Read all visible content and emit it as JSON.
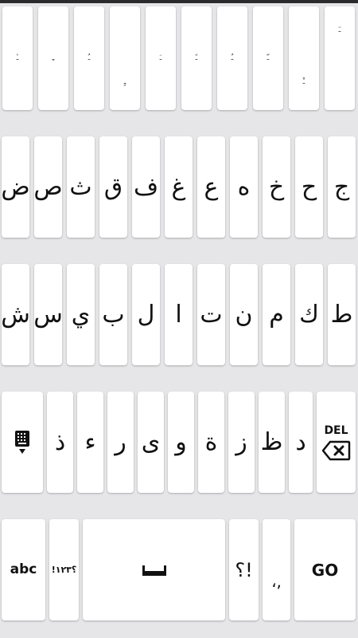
{
  "keyboard": {
    "row1": [
      "ـٔ",
      "ـِ",
      "ـُ",
      "ـٍ",
      "ـَ",
      "ـً",
      "ـٌ",
      "ـّ",
      "ـْ",
      "ـٓ"
    ],
    "row2": [
      "ض",
      "ص",
      "ث",
      "ق",
      "ف",
      "غ",
      "ع",
      "ه",
      "خ",
      "ح",
      "ج"
    ],
    "row3": [
      "ش",
      "س",
      "ي",
      "ب",
      "ل",
      "ا",
      "ت",
      "ن",
      "م",
      "ك",
      "ط"
    ],
    "row4": [
      "ذ",
      "ء",
      "ر",
      "ى",
      "و",
      "ة",
      "ز",
      "ظ",
      "د"
    ],
    "row5": {
      "abc": "abc",
      "numbers": "!؟١٢٣",
      "punct_q": "؟!",
      "comma": "،,",
      "go": "GO"
    },
    "del_label": "DEL"
  },
  "colors": {
    "background": "#e6e6e8",
    "key": "#ffffff",
    "text": "#111111"
  },
  "icons": [
    "keyboard-switch-icon",
    "backspace-icon",
    "space-bar-icon"
  ]
}
